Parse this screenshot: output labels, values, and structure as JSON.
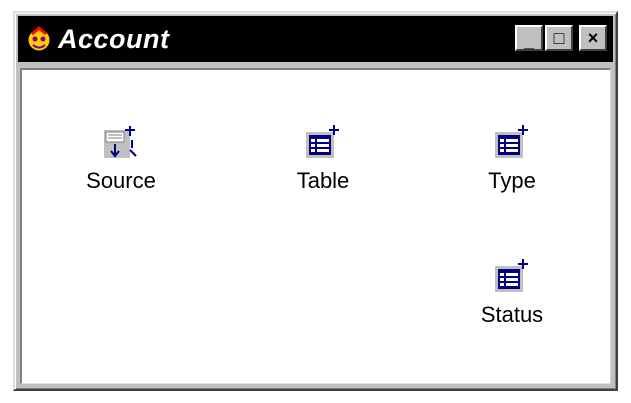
{
  "window": {
    "title": "Account",
    "icon": "account-app-icon",
    "controls": {
      "minimize": "_",
      "maximize": "□",
      "close": "×"
    }
  },
  "items": [
    {
      "label": "Source",
      "icon": "source-query-icon"
    },
    {
      "label": "Table",
      "icon": "table-icon"
    },
    {
      "label": "Type",
      "icon": "table-icon"
    },
    {
      "label": "Status",
      "icon": "table-icon"
    }
  ],
  "colors": {
    "titlebar": "#000000",
    "title_text": "#ffffff",
    "icon_blue": "#000080",
    "face": "#c0c0c0"
  }
}
